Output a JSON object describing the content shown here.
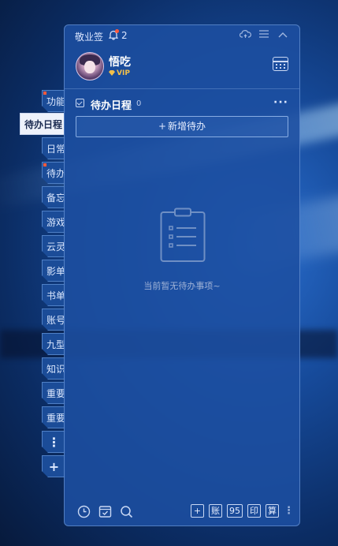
{
  "app": {
    "title": "敬业签",
    "notification_count": "2"
  },
  "side_tabs": [
    {
      "label": "功能",
      "dot": true,
      "active": false
    },
    {
      "label": "待办日程",
      "dot": false,
      "active": true
    },
    {
      "label": "日常",
      "dot": false,
      "active": false
    },
    {
      "label": "待办",
      "dot": true,
      "active": false
    },
    {
      "label": "备忘",
      "dot": false,
      "active": false
    },
    {
      "label": "游戏",
      "dot": false,
      "active": false
    },
    {
      "label": "云灵",
      "dot": false,
      "active": false
    },
    {
      "label": "影单",
      "dot": false,
      "active": false
    },
    {
      "label": "书单",
      "dot": false,
      "active": false
    },
    {
      "label": "账号",
      "dot": false,
      "active": false
    },
    {
      "label": "九型",
      "dot": false,
      "active": false
    },
    {
      "label": "知识",
      "dot": false,
      "active": false
    },
    {
      "label": "重要",
      "dot": false,
      "active": false
    },
    {
      "label": "重要",
      "dot": false,
      "active": false
    }
  ],
  "side_more": "⋮",
  "side_add": "+",
  "user": {
    "name": "悟吃",
    "badge": "VIP"
  },
  "section": {
    "title": "待办日程",
    "count": "0",
    "more": "···"
  },
  "add_button": {
    "plus": "+",
    "label": "新增待办"
  },
  "empty": {
    "text": "当前暂无待办事项~"
  },
  "bottom": {
    "buttons": [
      "+",
      "账",
      "95",
      "印",
      "算"
    ],
    "more": "⋮"
  },
  "colors": {
    "accent": "#1c4ea0",
    "tab_active_bg": "#eef2fb",
    "notify_dot": "#ff5a3c",
    "vip": "#f3c04a"
  }
}
